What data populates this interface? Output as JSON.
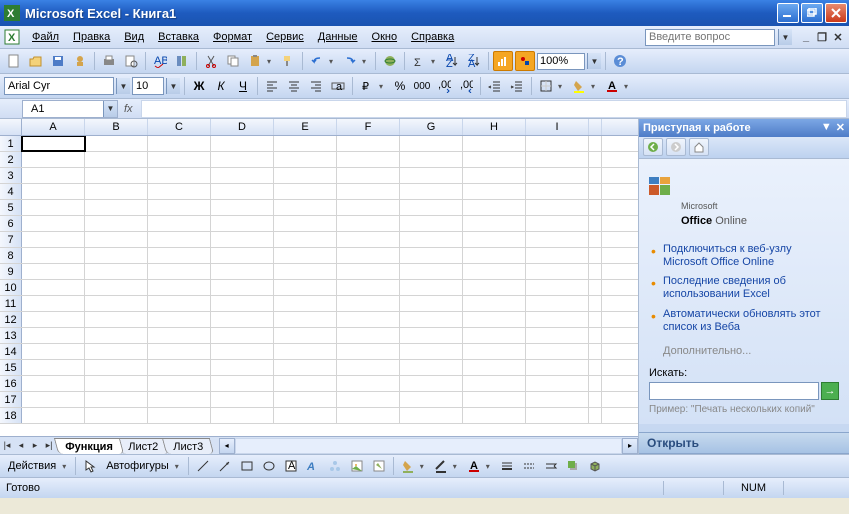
{
  "title": "Microsoft Excel - Книга1",
  "menu": [
    "Файл",
    "Правка",
    "Вид",
    "Вставка",
    "Формат",
    "Сервис",
    "Данные",
    "Окно",
    "Справка"
  ],
  "help_placeholder": "Введите вопрос",
  "font_name": "Arial Cyr",
  "font_size": "10",
  "zoom": "100%",
  "namebox": "A1",
  "fx": "fx",
  "columns": [
    "A",
    "B",
    "C",
    "D",
    "E",
    "F",
    "G",
    "H",
    "I"
  ],
  "rows": [
    "1",
    "2",
    "3",
    "4",
    "5",
    "6",
    "7",
    "8",
    "9",
    "10",
    "11",
    "12",
    "13",
    "14",
    "15",
    "16",
    "17",
    "18"
  ],
  "sheets": {
    "active": "Функция",
    "others": [
      "Лист2",
      "Лист3"
    ]
  },
  "taskpane": {
    "title": "Приступая к работе",
    "office_ms": "Microsoft",
    "office_brand": "Office",
    "office_online": "Online",
    "links": [
      "Подключиться к веб-узлу Microsoft Office Online",
      "Последние сведения об использовании Excel",
      "Автоматически обновлять этот список из Веба"
    ],
    "more": "Дополнительно...",
    "search_label": "Искать:",
    "example": "Пример: \"Печать нескольких копий\"",
    "open": "Открыть"
  },
  "drawing": {
    "actions": "Действия",
    "autoshapes": "Автофигуры"
  },
  "status": {
    "ready": "Готово",
    "num": "NUM"
  }
}
